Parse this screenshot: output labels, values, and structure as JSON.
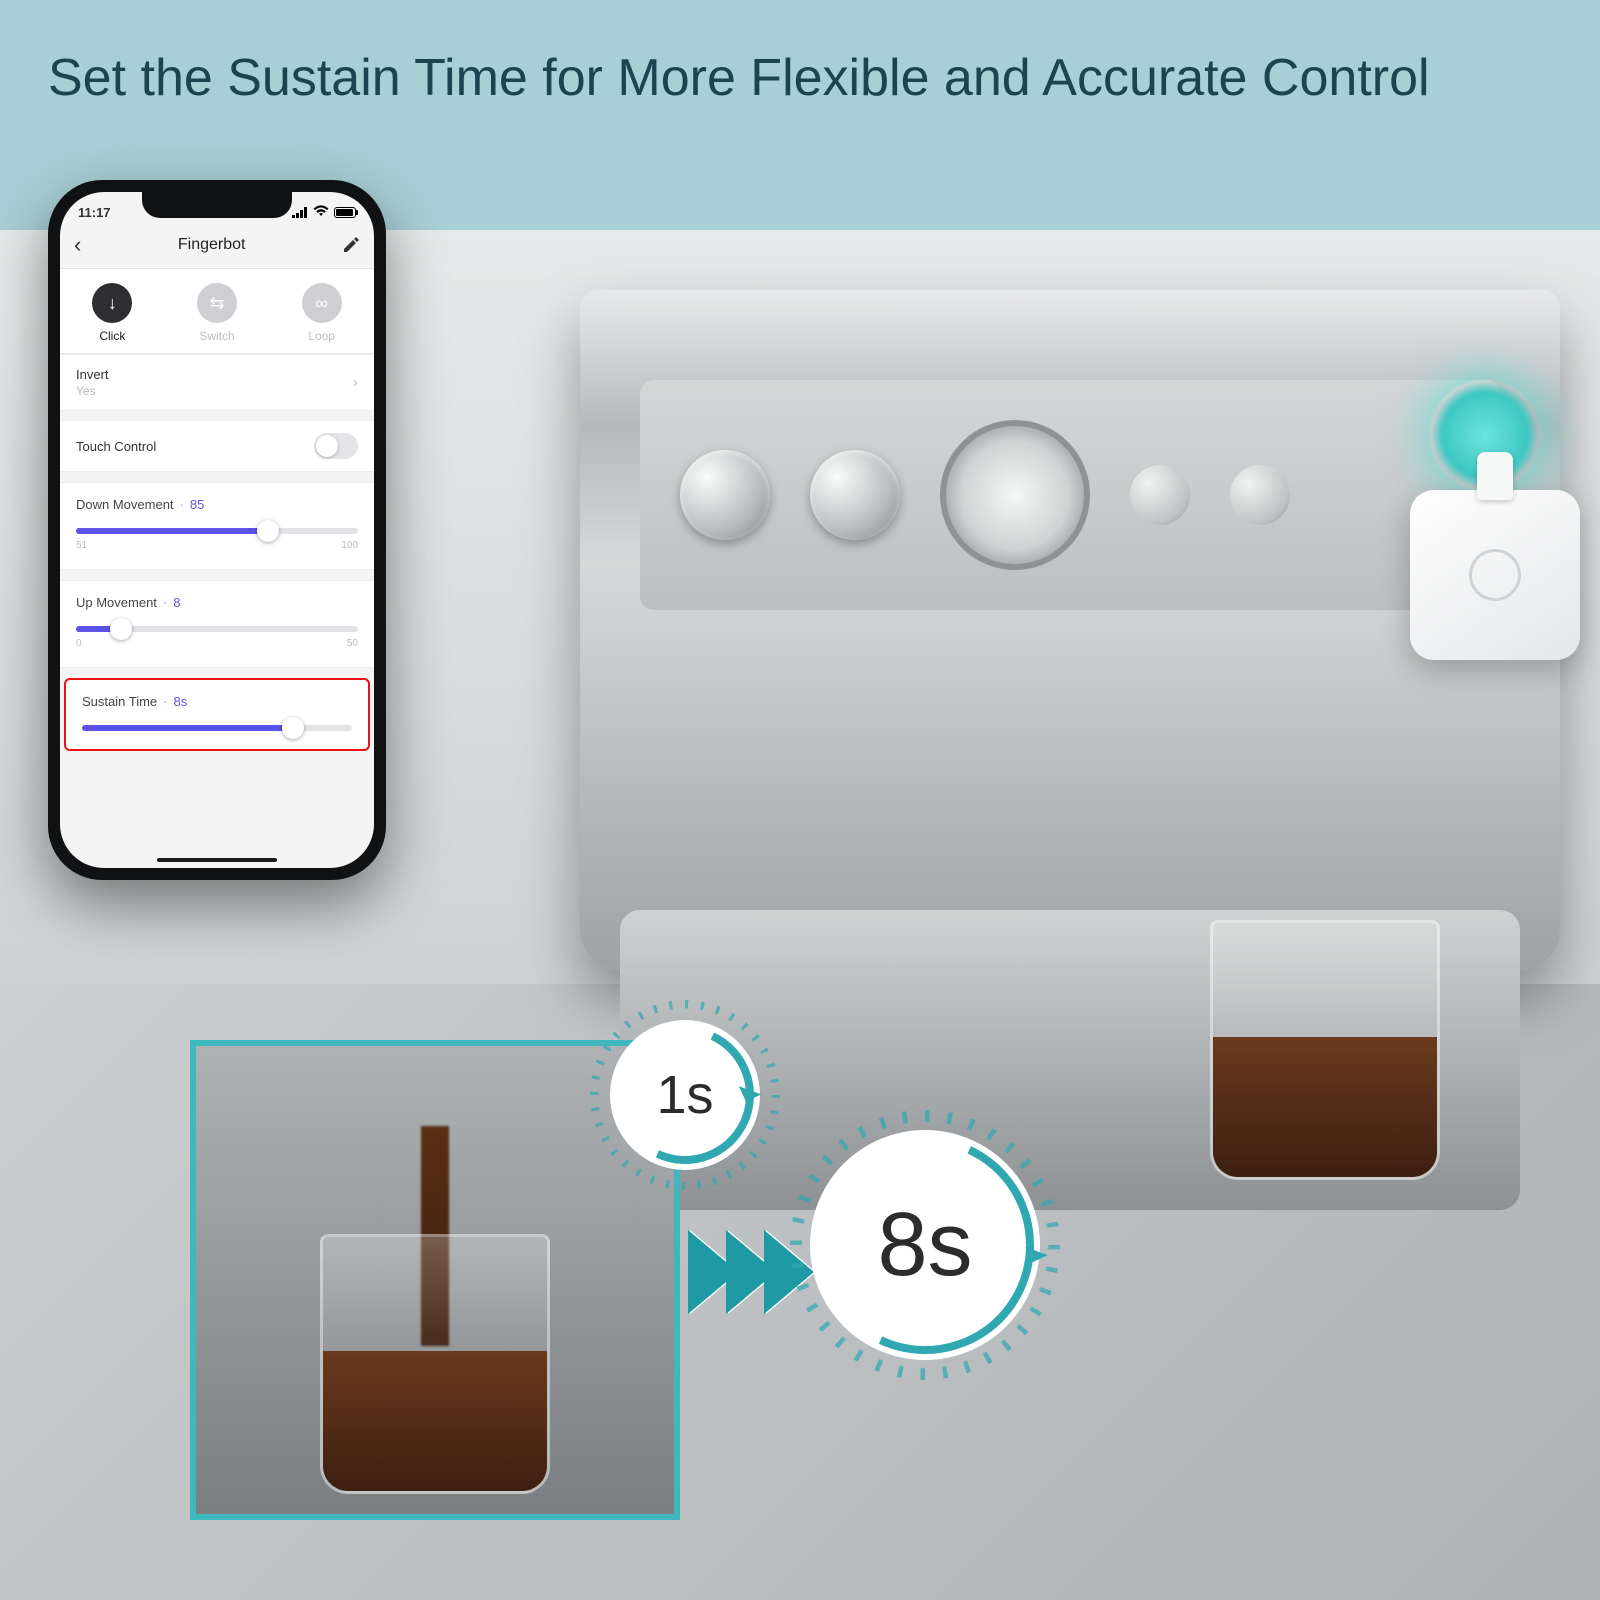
{
  "banner": {
    "headline": "Set the Sustain Time for More Flexible and Accurate Control"
  },
  "phone": {
    "status_time": "11:17",
    "title": "Fingerbot",
    "modes": {
      "click": "Click",
      "switch": "Switch",
      "loop": "Loop"
    },
    "invert": {
      "label": "Invert",
      "value": "Yes"
    },
    "touch_control": {
      "label": "Touch Control"
    },
    "down": {
      "label": "Down Movement",
      "value": "85",
      "min": "51",
      "max": "100",
      "fill_pct": 68
    },
    "up": {
      "label": "Up Movement",
      "value": "8",
      "min": "0",
      "max": "50",
      "fill_pct": 16
    },
    "sustain": {
      "label": "Sustain Time",
      "value": "8s",
      "fill_pct": 78
    }
  },
  "timers": {
    "short": "1s",
    "long": "8s"
  }
}
